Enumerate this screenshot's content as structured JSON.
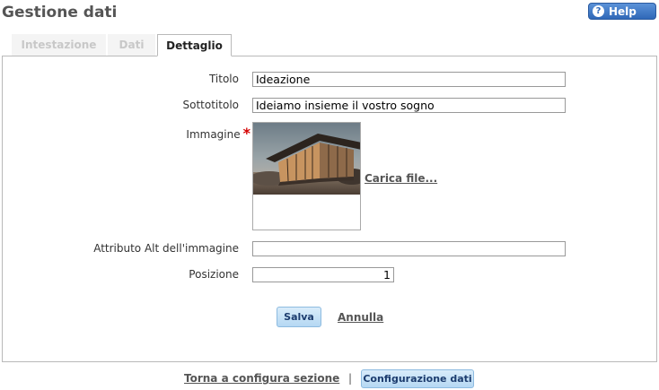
{
  "header": {
    "title": "Gestione dati",
    "help_label": "Help",
    "help_icon": "question-icon"
  },
  "tabs": [
    {
      "label": "Intestazione",
      "active": false
    },
    {
      "label": "Dati",
      "active": false
    },
    {
      "label": "Dettaglio",
      "active": true
    }
  ],
  "form": {
    "titolo": {
      "label": "Titolo",
      "value": "Ideazione"
    },
    "sottotitolo": {
      "label": "Sottotitolo",
      "value": "Ideiamo insieme il vostro sogno"
    },
    "immagine": {
      "label": "Immagine",
      "required_mark": "*",
      "upload_label": "Carica file..."
    },
    "alt": {
      "label": "Attributo Alt dell'immagine",
      "value": ""
    },
    "posizione": {
      "label": "Posizione",
      "value": "1"
    }
  },
  "actions": {
    "save_label": "Salva",
    "cancel_label": "Annulla"
  },
  "footer": {
    "back_label": "Torna a configura sezione",
    "separator": "|",
    "config_label": "Configurazione dati"
  },
  "colors": {
    "help_button": "#2f68b8",
    "action_button": "#b5d8f3",
    "required": "#d40000"
  }
}
